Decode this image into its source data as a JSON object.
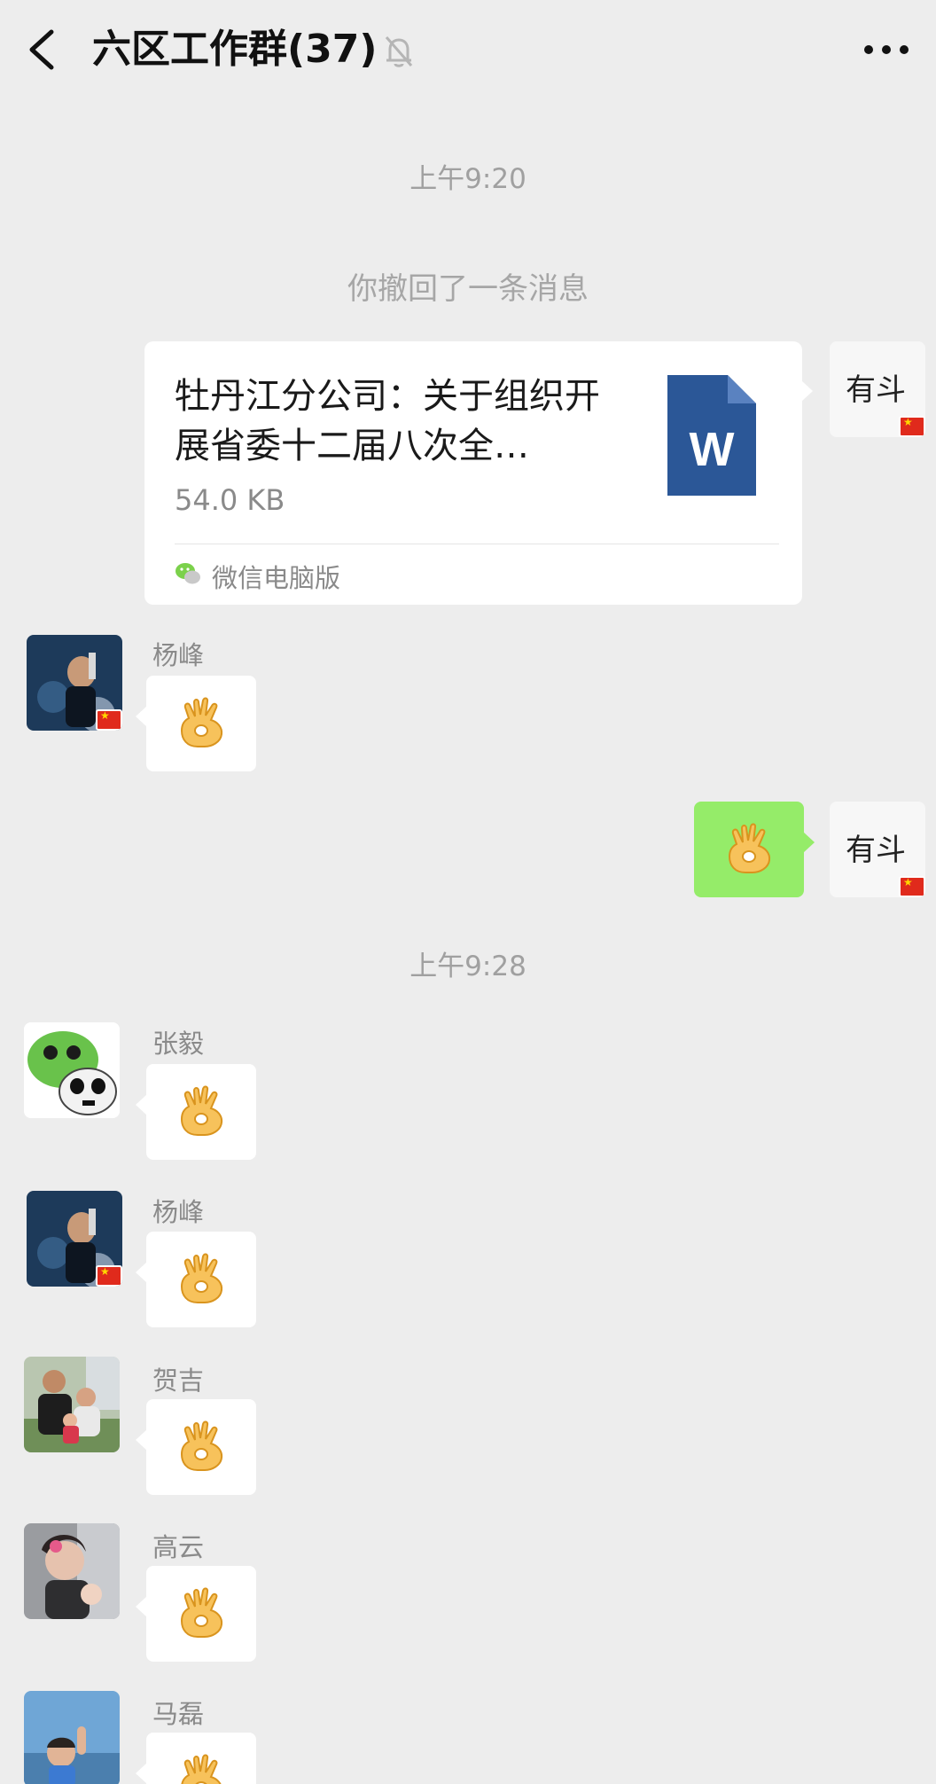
{
  "header": {
    "title": "六区工作群(37)",
    "back_icon": "chevron-left-icon",
    "mute_icon": "bell-off-icon",
    "more_icon": "more-dots-icon"
  },
  "timestamps": [
    "上午9:20",
    "上午9:28"
  ],
  "system_messages": [
    "你撤回了一条消息"
  ],
  "self": {
    "avatar_text": "有斗"
  },
  "file_message": {
    "title": "牡丹江分公司：关于组织开展省委十二届八次全…",
    "size": "54.0 KB",
    "file_icon_letter": "W",
    "source": "微信电脑版"
  },
  "messages": [
    {
      "sender": "杨峰",
      "content": "ok-hand-emoji"
    },
    {
      "sender": "self",
      "content": "ok-hand-emoji"
    },
    {
      "sender": "张毅",
      "content": "ok-hand-emoji"
    },
    {
      "sender": "杨峰",
      "content": "ok-hand-emoji"
    },
    {
      "sender": "贺吉",
      "content": "ok-hand-emoji"
    },
    {
      "sender": "高云",
      "content": "ok-hand-emoji"
    },
    {
      "sender": "马磊",
      "content": "ok-hand-emoji"
    }
  ],
  "colors": {
    "background": "#ededed",
    "self_bubble": "#95ec69",
    "other_bubble": "#ffffff",
    "word_icon": "#2b5797"
  }
}
